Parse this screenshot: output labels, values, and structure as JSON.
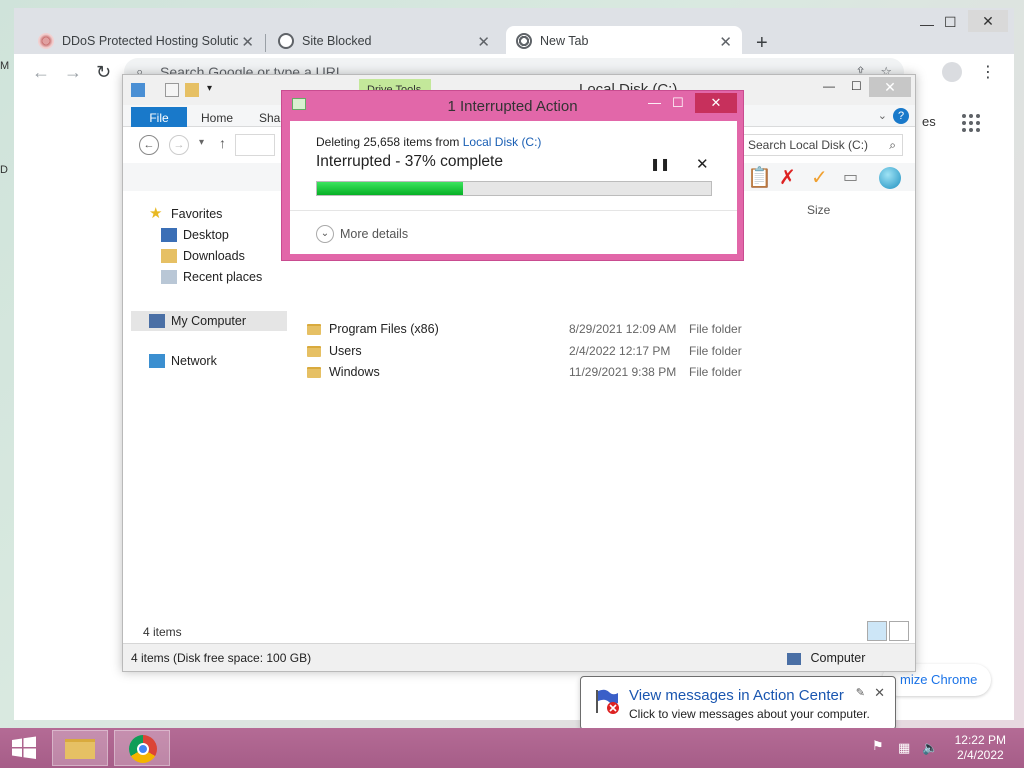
{
  "chrome": {
    "tabs": [
      {
        "label": "DDoS Protected Hosting Solution"
      },
      {
        "label": "Site Blocked"
      },
      {
        "label": "New Tab"
      }
    ],
    "omnibox_placeholder": "Search Google or type a URL",
    "customize_label": "mize Chrome",
    "edge_fragment": "es"
  },
  "explorer": {
    "title": "Local Disk (C:)",
    "drive_tools_label": "Drive Tools",
    "ribbon_tabs": [
      "File",
      "Home",
      "Shar"
    ],
    "search_placeholder": "Search Local Disk (C:)",
    "column_size": "Size",
    "nav": {
      "favorites": "Favorites",
      "desktop": "Desktop",
      "downloads": "Downloads",
      "recent": "Recent places",
      "mycomputer": "My Computer",
      "network": "Network"
    },
    "files": [
      {
        "name": "Program Files (x86)",
        "date": "8/29/2021 12:09 AM",
        "type": "File folder"
      },
      {
        "name": "Users",
        "date": "2/4/2022 12:17 PM",
        "type": "File folder"
      },
      {
        "name": "Windows",
        "date": "11/29/2021 9:38 PM",
        "type": "File folder"
      }
    ],
    "item_count": "4 items",
    "status_left": "4 items (Disk free space: 100 GB)",
    "status_right": "Computer"
  },
  "dialog": {
    "title": "1 Interrupted Action",
    "line1_prefix": "Deleting 25,658 items from ",
    "line1_link": "Local Disk (C:)",
    "status": "Interrupted - 37% complete",
    "progress": 0.37,
    "more_details": "More details"
  },
  "balloon": {
    "title": "View messages in Action Center",
    "text": "Click to view messages about your computer."
  },
  "clock": {
    "time": "12:22 PM",
    "date": "2/4/2022"
  },
  "colors": {
    "dialog_frame": "#e267a9",
    "taskbar": "#a65d88",
    "progress": "#06b025"
  }
}
